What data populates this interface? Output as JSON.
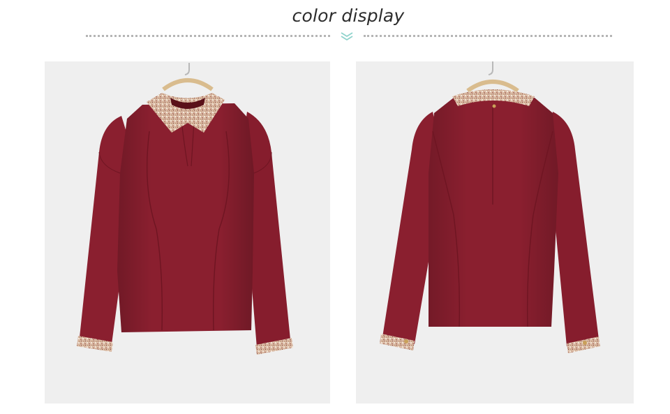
{
  "header": {
    "title": "color display",
    "chevron_icon": "double-chevron-down-icon",
    "accent_color": "#8fd3cc",
    "divider_color": "#b5b5b5"
  },
  "gallery": {
    "garment_color": "#8a1f2f",
    "collar_trim_color": "#d9b9a3",
    "panel_background": "#efefef",
    "views": [
      {
        "view": "front"
      },
      {
        "view": "back"
      }
    ]
  }
}
